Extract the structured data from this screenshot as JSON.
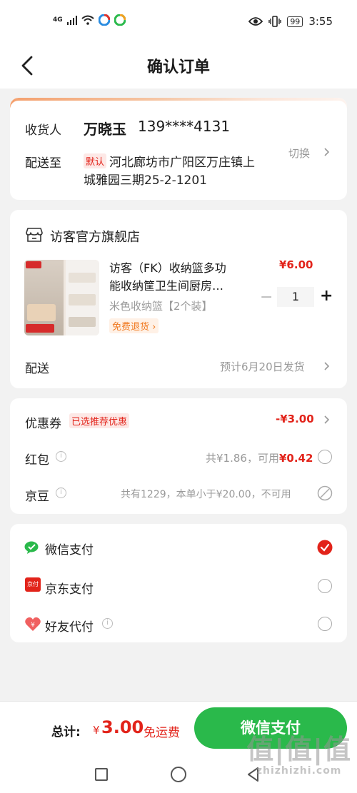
{
  "status_bar": {
    "network": "4G",
    "time": "3:55",
    "battery": "99"
  },
  "header": {
    "title": "确认订单"
  },
  "address": {
    "recipient_label": "收货人",
    "recipient_name": "万晓玉",
    "phone": "139****4131",
    "deliver_to_label": "配送至",
    "default_tag": "默认",
    "address_line1": "河北廊坊市广阳区万庄镇上",
    "address_line2": "城雅园三期25-2-1201",
    "switch_label": "切换"
  },
  "store": {
    "name": "访客官方旗舰店",
    "product_title_line1": "访客（FK）收纳篮多功",
    "product_title_line2": "能收纳筐卫生间厨房…",
    "price": "¥6.00",
    "spec": "米色收纳篮【2个装】",
    "return_tag": "免费退货",
    "quantity": "1",
    "minus": "−",
    "plus": "+",
    "shipping_label": "配送",
    "shipping_value": "预计6月20日发货"
  },
  "discounts": {
    "coupon_label": "优惠券",
    "coupon_tag": "已选推荐优惠",
    "coupon_value": "-¥3.00",
    "redpacket_label": "红包",
    "redpacket_value_prefix": "共¥1.86，可用",
    "redpacket_value_amount": "¥0.42",
    "jingdou_label": "京豆",
    "jingdou_value": "共有1229，本单小于¥20.00，不可用"
  },
  "payment": {
    "methods": [
      {
        "label": "微信支付",
        "selected": true
      },
      {
        "label": "京东支付",
        "selected": false
      },
      {
        "label": "好友代付",
        "selected": false
      }
    ],
    "jd_icon_text": "京付"
  },
  "bottom": {
    "total_label": "总计:",
    "currency": "¥",
    "amount": "3.00",
    "free_shipping": "免运费",
    "pay_button": "微信支付"
  },
  "watermark": {
    "logo": "值|值|值",
    "site": "zhizhizhi.com"
  },
  "colors": {
    "accent_red": "#e2231a",
    "wechat_green": "#2ab94b",
    "orange": "#f0781e"
  }
}
